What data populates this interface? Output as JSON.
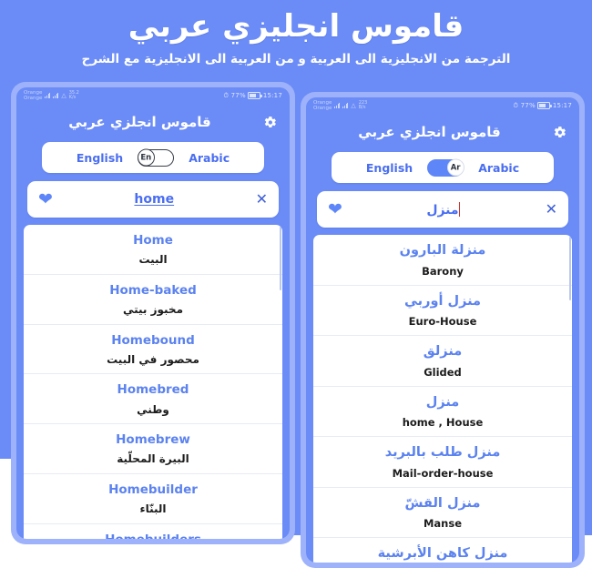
{
  "promo": {
    "title": "قاموس انجليزي عربي",
    "subtitle": "الترجمة من الانجليزية الى العربية و من العربية الى الانجليزية مع الشرح",
    "background_color": "#6b8cf7",
    "accent_color": "#5b82ef"
  },
  "phones": [
    {
      "id": "left",
      "status_bar": {
        "carrier_line1": "Orange",
        "carrier_line2": "Orange",
        "net_speed_value": "35.2",
        "net_speed_unit": "K/s",
        "battery_percent": "77%",
        "time": "15:17",
        "alarm_icon": "alarm-icon",
        "wifi_icon": "wifi-icon",
        "signal_icon": "signal-bars-icon",
        "battery_icon": "battery-icon"
      },
      "appbar": {
        "title": "قاموس انجلزي عربي",
        "settings_icon": "gear-icon"
      },
      "language_toggle": {
        "left_label": "English",
        "right_label": "Arabic",
        "knob_label": "En",
        "state": "off"
      },
      "search": {
        "favorite_icon": "heart-icon",
        "value": "home",
        "clear_icon": "close-icon",
        "has_caret": false
      },
      "results": [
        {
          "term": "Home",
          "definition": "البيت",
          "term_dir": "ltr",
          "def_dir": "rtl"
        },
        {
          "term": "Home-baked",
          "definition": "مخبوز بيتي",
          "term_dir": "ltr",
          "def_dir": "rtl"
        },
        {
          "term": "Homebound",
          "definition": "محصور في البيت",
          "term_dir": "ltr",
          "def_dir": "rtl"
        },
        {
          "term": "Homebred",
          "definition": "وطني",
          "term_dir": "ltr",
          "def_dir": "rtl"
        },
        {
          "term": "Homebrew",
          "definition": "البيرة المحلّية",
          "term_dir": "ltr",
          "def_dir": "rtl"
        },
        {
          "term": "Homebuilder",
          "definition": "البنّاء",
          "term_dir": "ltr",
          "def_dir": "rtl"
        },
        {
          "term": "Homebuilders",
          "definition": "",
          "term_dir": "ltr",
          "def_dir": "rtl"
        }
      ]
    },
    {
      "id": "right",
      "status_bar": {
        "carrier_line1": "Orange",
        "carrier_line2": "Orange",
        "net_speed_value": "223",
        "net_speed_unit": "B/s",
        "battery_percent": "77%",
        "time": "15:17",
        "alarm_icon": "alarm-icon",
        "wifi_icon": "wifi-icon",
        "signal_icon": "signal-bars-icon",
        "battery_icon": "battery-icon"
      },
      "appbar": {
        "title": "قاموس انجلزي عربي",
        "settings_icon": "gear-icon"
      },
      "language_toggle": {
        "left_label": "English",
        "right_label": "Arabic",
        "knob_label": "Ar",
        "state": "on"
      },
      "search": {
        "favorite_icon": "heart-icon",
        "value": "منزل",
        "clear_icon": "close-icon",
        "has_caret": true
      },
      "results": [
        {
          "term": "منزلة البارون",
          "definition": "Barony",
          "term_dir": "rtl",
          "def_dir": "ltr"
        },
        {
          "term": "منزل أوربي",
          "definition": "Euro-House",
          "term_dir": "rtl",
          "def_dir": "ltr"
        },
        {
          "term": "منزلق",
          "definition": "Glided",
          "term_dir": "rtl",
          "def_dir": "ltr"
        },
        {
          "term": "منزل",
          "definition": "home , House",
          "term_dir": "rtl",
          "def_dir": "ltr"
        },
        {
          "term": "منزل طلب بالبريد",
          "definition": "Mail-order-house",
          "term_dir": "rtl",
          "def_dir": "ltr"
        },
        {
          "term": "منزل القشّ",
          "definition": "Manse",
          "term_dir": "rtl",
          "def_dir": "ltr"
        },
        {
          "term": "منزل كاهن الأبرشية",
          "definition": "",
          "term_dir": "rtl",
          "def_dir": "ltr"
        }
      ]
    }
  ]
}
